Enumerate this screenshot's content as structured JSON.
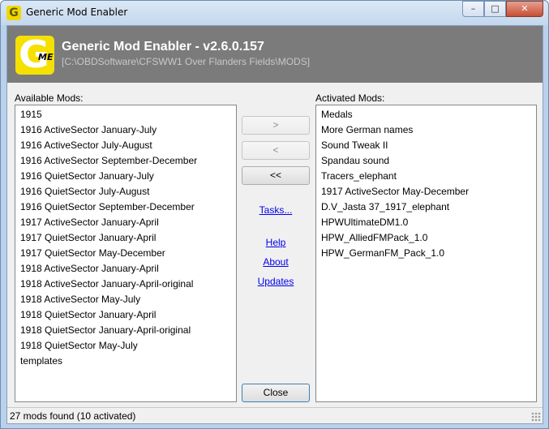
{
  "window": {
    "title": "Generic Mod Enabler",
    "icon": "G",
    "controls": {
      "minimize": "–",
      "maximize": "□",
      "close": "✕"
    }
  },
  "header": {
    "logo_letter": "G",
    "logo_sub": "ME",
    "app_title": "Generic Mod Enabler - v2.6.0.157",
    "path": "[C:\\OBDSoftware\\CFSWW1 Over Flanders Fields\\MODS]"
  },
  "available": {
    "label": "Available Mods:",
    "items": [
      "1915",
      "1916 ActiveSector January-July",
      "1916 ActiveSector July-August",
      "1916 ActiveSector September-December",
      "1916 QuietSector January-July",
      "1916 QuietSector July-August",
      "1916 QuietSector September-December",
      "1917 ActiveSector January-April",
      "1917 QuietSector January-April",
      "1917 QuietSector May-December",
      "1918 ActiveSector January-April",
      "1918 ActiveSector January-April-original",
      "1918 ActiveSector May-July",
      "1918 QuietSector January-April",
      "1918 QuietSector January-April-original",
      "1918 QuietSector May-July",
      "templates"
    ]
  },
  "activated": {
    "label": "Activated Mods:",
    "items": [
      "Medals",
      "More German names",
      "Sound Tweak II",
      "Spandau sound",
      "Tracers_elephant",
      "1917 ActiveSector May-December",
      "D.V_Jasta 37_1917_elephant",
      "HPWUltimateDM1.0",
      "HPW_AlliedFMPack_1.0",
      "HPW_GermanFM_Pack_1.0"
    ]
  },
  "buttons": {
    "activate": ">",
    "deactivate": "<",
    "deactivate_all": "<<",
    "close": "Close"
  },
  "links": {
    "tasks": "Tasks...",
    "help": "Help",
    "about": "About",
    "updates": "Updates"
  },
  "status": {
    "text": "27 mods found (10 activated)"
  }
}
